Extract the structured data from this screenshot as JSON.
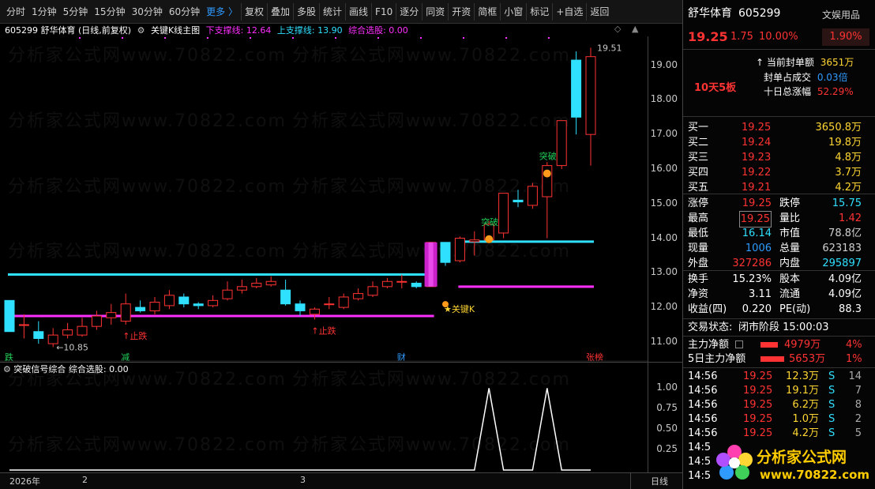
{
  "toolbar": {
    "periods": [
      "分时",
      "1分钟",
      "5分钟",
      "15分钟",
      "30分钟",
      "60分钟"
    ],
    "more": "更多 〉",
    "tools": [
      "复权",
      "叠加",
      "多股",
      "统计",
      "画线",
      "F10",
      "逐分",
      "同资",
      "开资",
      "简框",
      "小窗",
      "标记",
      "+自选",
      "返回"
    ]
  },
  "title_bar": {
    "code_name": "605299  舒华体育 (日线,前复权)",
    "indicator": "关键K线主图",
    "lower_label": "下支撑线: 12.64",
    "upper_label": "上支撑线: 13.90",
    "combo_label": "综合选股: 0.00"
  },
  "sub_title": {
    "name": "突破信号综合",
    "combo": "综合选股: 0.00"
  },
  "watermark": "分析家公式网www.70822.com",
  "colors": {
    "up": "#ff3333",
    "down": "#2fe0ff",
    "support_upper": "#2fe0ff",
    "support_lower": "#ff2fff",
    "background": "#000000"
  },
  "chart_data": {
    "type": "candlestick",
    "ylim": [
      10.7,
      19.7
    ],
    "yticks": [
      11.0,
      12.0,
      13.0,
      14.0,
      15.0,
      16.0,
      17.0,
      18.0,
      19.0
    ],
    "ytick_labels": [
      "11.00",
      "12.00",
      "13.00",
      "14.00",
      "15.00",
      "16.00",
      "17.00",
      "18.00",
      "19.00"
    ],
    "candles": [
      {
        "o": 12.2,
        "c": 11.3,
        "h": 12.2,
        "l": 11.3
      },
      {
        "o": 11.5,
        "c": 11.5,
        "h": 11.8,
        "l": 11.1
      },
      {
        "o": 11.3,
        "c": 11.1,
        "h": 11.6,
        "l": 10.95
      },
      {
        "o": 10.95,
        "c": 11.2,
        "h": 11.4,
        "l": 10.85
      },
      {
        "o": 11.2,
        "c": 11.35,
        "h": 11.55,
        "l": 11.1
      },
      {
        "o": 11.2,
        "c": 11.45,
        "h": 11.7,
        "l": 11.15
      },
      {
        "o": 11.45,
        "c": 11.75,
        "h": 11.9,
        "l": 11.35
      },
      {
        "o": 11.7,
        "c": 11.85,
        "h": 12.1,
        "l": 11.5
      },
      {
        "o": 11.6,
        "c": 12.1,
        "h": 12.4,
        "l": 11.5
      },
      {
        "o": 12.0,
        "c": 11.9,
        "h": 12.2,
        "l": 11.85
      },
      {
        "o": 11.9,
        "c": 12.15,
        "h": 12.3,
        "l": 11.8
      },
      {
        "o": 12.05,
        "c": 12.35,
        "h": 12.5,
        "l": 11.95
      },
      {
        "o": 12.3,
        "c": 12.1,
        "h": 12.4,
        "l": 12.0
      },
      {
        "o": 12.1,
        "c": 12.05,
        "h": 12.15,
        "l": 11.95
      },
      {
        "o": 12.05,
        "c": 12.2,
        "h": 12.35,
        "l": 12.0
      },
      {
        "o": 12.25,
        "c": 12.5,
        "h": 12.75,
        "l": 12.2
      },
      {
        "o": 12.5,
        "c": 12.6,
        "h": 12.8,
        "l": 12.4
      },
      {
        "o": 12.6,
        "c": 12.7,
        "h": 12.85,
        "l": 12.55
      },
      {
        "o": 12.65,
        "c": 12.75,
        "h": 12.9,
        "l": 12.6
      },
      {
        "o": 12.5,
        "c": 12.1,
        "h": 12.8,
        "l": 12.05
      },
      {
        "o": 12.1,
        "c": 11.9,
        "h": 12.2,
        "l": 11.75
      },
      {
        "o": 11.8,
        "c": 11.95,
        "h": 12.0,
        "l": 11.65
      },
      {
        "o": 12.1,
        "c": 12.1,
        "h": 12.3,
        "l": 11.95
      },
      {
        "o": 12.0,
        "c": 12.3,
        "h": 12.4,
        "l": 11.95
      },
      {
        "o": 12.25,
        "c": 12.4,
        "h": 12.55,
        "l": 12.2
      },
      {
        "o": 12.35,
        "c": 12.6,
        "h": 12.75,
        "l": 12.3
      },
      {
        "o": 12.6,
        "c": 12.75,
        "h": 12.85,
        "l": 12.55
      },
      {
        "o": 12.75,
        "c": 12.75,
        "h": 12.95,
        "l": 12.55
      },
      {
        "o": 12.7,
        "c": 12.6,
        "h": 12.75,
        "l": 12.55
      },
      {
        "o": 12.6,
        "c": 13.88,
        "h": 13.88,
        "l": 12.6
      },
      {
        "o": 13.88,
        "c": 13.3,
        "h": 13.88,
        "l": 13.2
      },
      {
        "o": 13.35,
        "c": 14.0,
        "h": 14.05,
        "l": 13.3
      },
      {
        "o": 13.9,
        "c": 13.95,
        "h": 14.2,
        "l": 13.5
      },
      {
        "o": 13.95,
        "c": 14.4,
        "h": 14.5,
        "l": 13.95
      },
      {
        "o": 14.15,
        "c": 15.3,
        "h": 15.3,
        "l": 14.0
      },
      {
        "o": 15.1,
        "c": 15.05,
        "h": 15.4,
        "l": 14.9
      },
      {
        "o": 14.95,
        "c": 15.5,
        "h": 15.6,
        "l": 14.85
      },
      {
        "o": 15.2,
        "c": 16.1,
        "h": 16.2,
        "l": 14.0
      },
      {
        "o": 16.1,
        "c": 17.4,
        "h": 17.4,
        "l": 16.0
      },
      {
        "o": 19.15,
        "c": 17.5,
        "h": 19.4,
        "l": 17.0
      },
      {
        "o": 17.0,
        "c": 19.25,
        "h": 19.51,
        "l": 16.1
      }
    ],
    "support_lines": [
      {
        "name": "上支撑线",
        "value": 12.95,
        "from": 0,
        "to": 29
      },
      {
        "name": "下支撑线",
        "value": 11.75,
        "from": 0,
        "to": 29
      },
      {
        "name": "上支撑线",
        "value": 13.9,
        "from": 31,
        "to": 40
      },
      {
        "name": "下支撑线",
        "value": 12.6,
        "from": 31,
        "to": 40
      }
    ],
    "annotations": [
      {
        "text": "←10.85",
        "index": 3,
        "value": 10.85
      },
      {
        "text": "19.51",
        "index": 40,
        "value": 19.51
      },
      {
        "text": "止跌",
        "index": 8,
        "value": 11.5
      },
      {
        "text": "止跌",
        "index": 21,
        "value": 11.65
      },
      {
        "text": "突破",
        "index": 33,
        "value": 14.2
      },
      {
        "text": "突破",
        "index": 37,
        "value": 16.1
      },
      {
        "text": "★关键K",
        "index": 30,
        "value": 12.0
      }
    ],
    "bottom_marks": [
      {
        "text": "跌",
        "index": 0,
        "color": "#22d05a"
      },
      {
        "text": "减",
        "index": 8,
        "color": "#22d05a"
      },
      {
        "text": "财",
        "index": 27,
        "color": "#2f9bff"
      },
      {
        "text": "张榜",
        "index": 40,
        "color": "#ff3333"
      }
    ],
    "signal": {
      "ylim": [
        0,
        1.1
      ],
      "yticks": [
        0.25,
        0.5,
        0.75,
        1.0
      ],
      "ytick_labels": [
        "0.25",
        "0.50",
        "0.75",
        "1.00"
      ],
      "peaks": [
        33,
        37
      ]
    }
  },
  "xaxis": {
    "labels": [
      {
        "text": "2026年",
        "index": 0
      },
      {
        "text": "2",
        "index": 5
      },
      {
        "text": "3",
        "index": 20
      }
    ],
    "period": "日线"
  },
  "panel": {
    "name": "舒华体育",
    "code": "605299",
    "sector": "文娱用品",
    "sector_pct": "1.90%",
    "price": "19.25",
    "change": "1.75",
    "change_pct": "10.00%",
    "board_tag": "10天5板",
    "seal_label": "当前封单额",
    "seal_value": "3651万",
    "seal_ratio_label": "封单占成交",
    "seal_ratio_value": "0.03倍",
    "ten_day_label": "十日总涨幅",
    "ten_day_value": "52.29%",
    "bids": [
      {
        "label": "买一",
        "price": "19.25",
        "vol": "3650.8万"
      },
      {
        "label": "买二",
        "price": "19.24",
        "vol": "19.8万"
      },
      {
        "label": "买三",
        "price": "19.23",
        "vol": "4.8万"
      },
      {
        "label": "买四",
        "price": "19.22",
        "vol": "3.7万"
      },
      {
        "label": "买五",
        "price": "19.21",
        "vol": "4.2万"
      }
    ],
    "stats": [
      {
        "l1": "涨停",
        "v1": "19.25",
        "c1": "#ff3333",
        "l2": "跌停",
        "v2": "15.75",
        "c2": "#2fe0ff"
      },
      {
        "l1": "最高",
        "v1": "19.25",
        "c1": "#ff3333",
        "l2": "量比",
        "v2": "1.42",
        "c2": "#ff3333"
      },
      {
        "l1": "最低",
        "v1": "16.14",
        "c1": "#2fe0ff",
        "l2": "市值",
        "v2": "78.8亿",
        "c2": "#d0d0d0"
      },
      {
        "l1": "现量",
        "v1": "1006",
        "c1": "#2f9bff",
        "l2": "总量",
        "v2": "623183",
        "c2": "#d0d0d0"
      },
      {
        "l1": "外盘",
        "v1": "327286",
        "c1": "#ff3333",
        "l2": "内盘",
        "v2": "295897",
        "c2": "#2fe0ff"
      }
    ],
    "stats2": [
      {
        "l1": "换手",
        "v1": "15.23%",
        "l2": "股本",
        "v2": "4.09亿"
      },
      {
        "l1": "净资",
        "v1": "3.11",
        "l2": "流通",
        "v2": "4.09亿"
      },
      {
        "l1": "收益(四)",
        "v1": "0.220",
        "l2": "PE(动)",
        "v2": "88.3"
      }
    ],
    "trade_status_label": "交易状态:",
    "trade_status_value": "闭市阶段 15:00:03",
    "main_flow_label": "主力净额",
    "main_flow_value": "4979万",
    "main_flow_pct": "4%",
    "main5_label": "5日主力净额",
    "main5_value": "5653万",
    "main5_pct": "1%",
    "ticks": [
      {
        "time": "14:56",
        "price": "19.25",
        "vol": "12.3万",
        "side": "S",
        "n": "14"
      },
      {
        "time": "14:56",
        "price": "19.25",
        "vol": "19.1万",
        "side": "S",
        "n": "7"
      },
      {
        "time": "14:56",
        "price": "19.25",
        "vol": "6.2万",
        "side": "S",
        "n": "8"
      },
      {
        "time": "14:56",
        "price": "19.25",
        "vol": "1.0万",
        "side": "S",
        "n": "2"
      },
      {
        "time": "14:56",
        "price": "19.25",
        "vol": "4.2万",
        "side": "S",
        "n": "5"
      },
      {
        "time": "14:5",
        "price": "",
        "vol": "",
        "side": "",
        "n": ""
      },
      {
        "time": "14:5",
        "price": "",
        "vol": "",
        "side": "",
        "n": ""
      },
      {
        "time": "14:5",
        "price": "",
        "vol": "",
        "side": "",
        "n": ""
      }
    ]
  },
  "logo": {
    "title": "分析家公式网",
    "url": "www.70822.com"
  }
}
